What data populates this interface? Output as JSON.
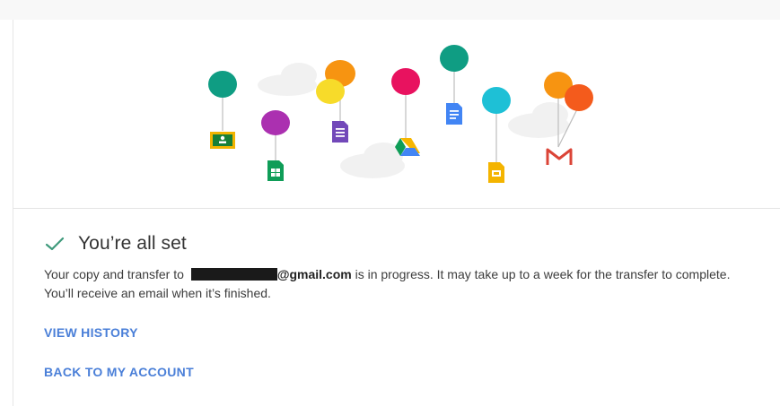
{
  "status": {
    "title": "You’re all set"
  },
  "message": {
    "prefix": "Your copy and transfer to ",
    "email_domain": "@gmail.com",
    "suffix": " is in progress. It may take up to a week for the transfer to complete. You’ll receive an email when it’s finished."
  },
  "links": {
    "view_history": "VIEW HISTORY",
    "back_to_account": "BACK TO MY ACCOUNT"
  },
  "colors": {
    "link": "#4a7fd8",
    "check": "#3f9a7c",
    "balloon_teal": "#0f9d83",
    "balloon_purple": "#ab30b0",
    "balloon_orange": "#f79411",
    "balloon_yellow": "#f7db2a",
    "balloon_pink": "#e8125f",
    "balloon_cyan": "#1ec0d6",
    "balloon_red": "#f45b1c"
  },
  "icons": [
    "classroom-icon",
    "sheets-icon",
    "forms-icon",
    "drive-icon",
    "docs-icon",
    "slides-icon",
    "gmail-icon",
    "check-icon"
  ]
}
